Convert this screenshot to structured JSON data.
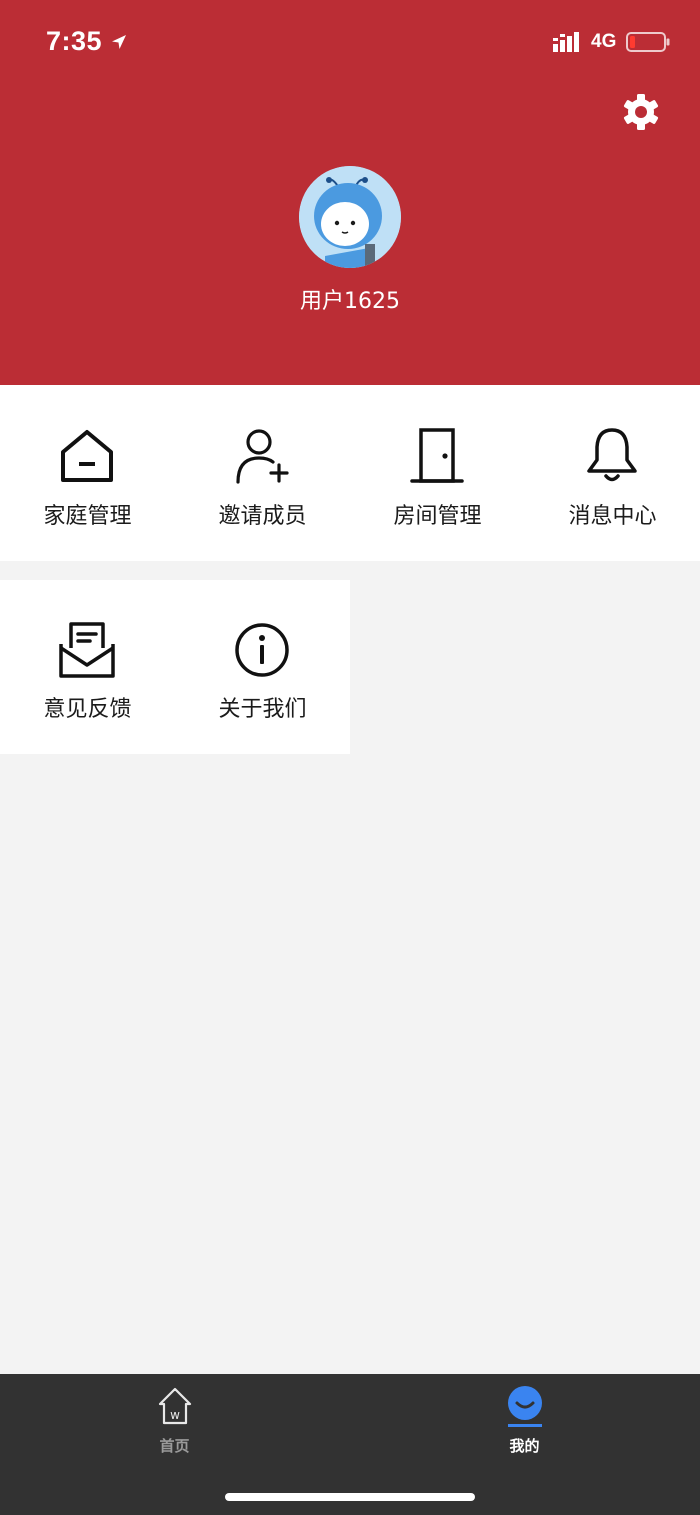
{
  "status_bar": {
    "time": "7:35",
    "network": "4G"
  },
  "header": {
    "username": "用户1625",
    "accent_color": "#bb2d35"
  },
  "menu": {
    "row1": [
      {
        "label": "家庭管理",
        "icon": "home-icon"
      },
      {
        "label": "邀请成员",
        "icon": "add-user-icon"
      },
      {
        "label": "房间管理",
        "icon": "door-icon"
      },
      {
        "label": "消息中心",
        "icon": "bell-icon"
      }
    ],
    "row2": [
      {
        "label": "意见反馈",
        "icon": "mail-icon"
      },
      {
        "label": "关于我们",
        "icon": "info-icon"
      }
    ]
  },
  "tabbar": {
    "home_label": "首页",
    "mine_label": "我的",
    "active_color": "#3a84f0"
  }
}
